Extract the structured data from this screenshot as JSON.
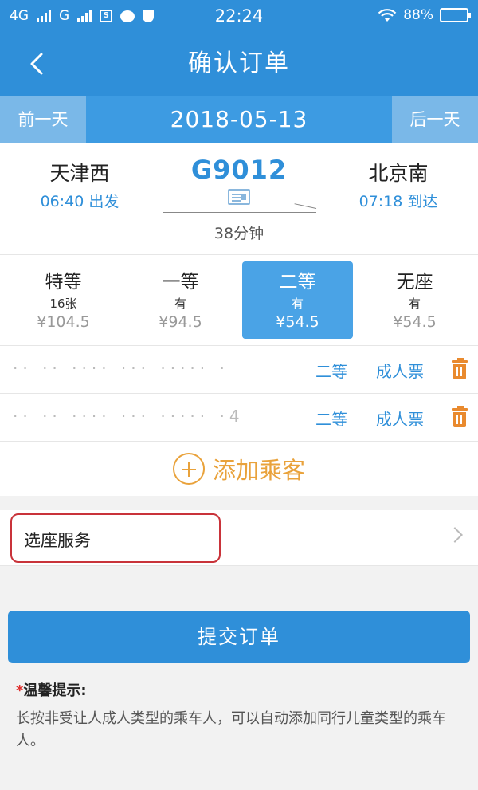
{
  "status_bar": {
    "network1": "4G",
    "network2": "G",
    "sim_badge": "S",
    "time": "22:24",
    "battery": "88%",
    "battery_level": 0.88
  },
  "header": {
    "title": "确认订单",
    "back_icon": "chevron-left"
  },
  "date_bar": {
    "prev_label": "前一天",
    "date": "2018-05-13",
    "next_label": "后一天"
  },
  "train": {
    "from_station": "天津西",
    "from_time": "06:40 出发",
    "code": "G9012",
    "to_station": "北京南",
    "to_time": "07:18 到达",
    "duration": "38分钟"
  },
  "seat_classes": [
    {
      "name": "特等",
      "availability": "16张",
      "price": "¥104.5",
      "selected": false
    },
    {
      "name": "一等",
      "availability": "有",
      "price": "¥94.5",
      "selected": false
    },
    {
      "name": "二等",
      "availability": "有",
      "price": "¥54.5",
      "selected": true
    },
    {
      "name": "无座",
      "availability": "有",
      "price": "¥54.5",
      "selected": false
    }
  ],
  "passengers": [
    {
      "info": "·· ·· ···· ··· ····· ·",
      "seat": "二等",
      "ticket_type": "成人票"
    },
    {
      "info": "·· ·· ···· ··· ····· ·4",
      "seat": "二等",
      "ticket_type": "成人票"
    }
  ],
  "add_passenger": {
    "label": "添加乘客"
  },
  "seat_service": {
    "label": "选座服务"
  },
  "submit": {
    "label": "提交订单"
  },
  "tips": {
    "star": "*",
    "title": "温馨提示:",
    "text": "长按非受让人成人类型的乘车人，可以自动添加同行儿童类型的乘车人。"
  },
  "colors": {
    "primary": "#2f8fd9",
    "accent": "#e9a23b",
    "highlight_border": "#c9333a"
  }
}
